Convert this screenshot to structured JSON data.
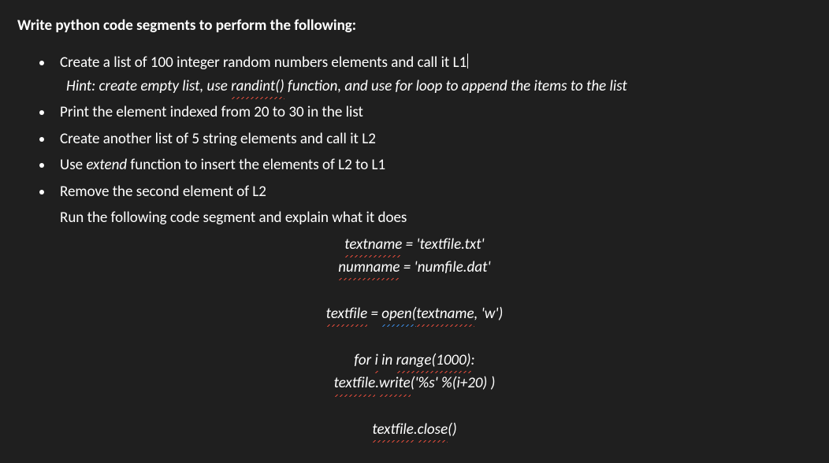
{
  "heading": "Write python code segments to perform the following:",
  "bullets": {
    "b1_pre": "Create a list of 100 integer random numbers elements and call it L1",
    "b1_hint_pre": "Hint: create empty list, use ",
    "b1_hint_randint": "randint()",
    "b1_hint_post": " function, and use for loop to append the items to the list",
    "b2": "Print the element indexed from 20 to 30 in the list",
    "b3": "Create another list of 5 string elements and call it L2",
    "b4_pre": "Use ",
    "b4_em": "extend",
    "b4_post": " function to insert the elements of L2 to L1",
    "b5": "Remove the second element of L2",
    "b6": "Run the following code segment and explain what it does"
  },
  "code": {
    "l1_textname": "textname",
    "l1_rest": " = 'textfile.txt'",
    "l2_numname": "numname",
    "l2_rest": " = 'numfile.dat'",
    "l3_textfile": "textfile",
    "l3_eq": " = ",
    "l3_open": "open(",
    "l3_open_arg": "textname",
    "l3_rest": ", 'w')",
    "l4_pre": "for ",
    "l4_i": "i",
    "l4_mid": " in ",
    "l4_range": "range(1000)",
    "l4_post": ":",
    "l5_textfile": "textfile",
    "l5_dot": ".",
    "l5_write": "write",
    "l5_rest": "('%s' %(i+20) )",
    "l6_textfile": "textfile",
    "l6_dot": ".",
    "l6_close": "close",
    "l6_rest": "()"
  }
}
